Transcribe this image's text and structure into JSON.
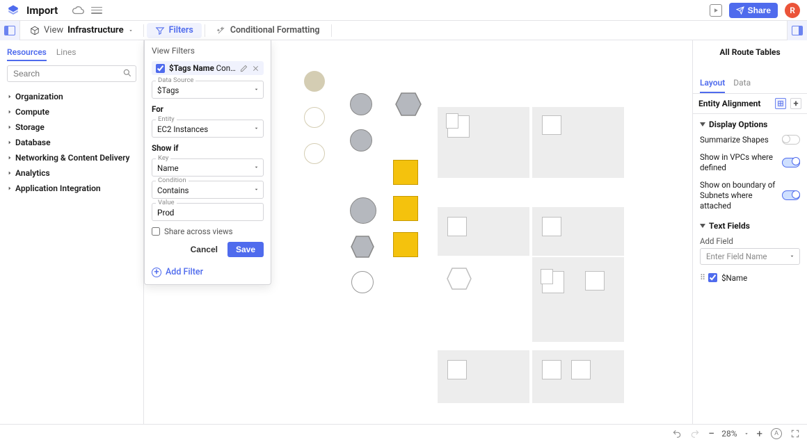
{
  "header": {
    "doc_title": "Import",
    "share_label": "Share",
    "avatar_letter": "R"
  },
  "toolbar": {
    "view_word": "View",
    "view_name": "Infrastructure",
    "filters_label": "Filters",
    "cond_fmt_label": "Conditional Formatting"
  },
  "sidebar": {
    "tabs": [
      "Resources",
      "Lines"
    ],
    "active_tab": 0,
    "search_placeholder": "Search",
    "tree": [
      "Organization",
      "Compute",
      "Storage",
      "Database",
      "Networking & Content Delivery",
      "Analytics",
      "Application Integration"
    ]
  },
  "filter_panel": {
    "title": "View Filters",
    "chip_field": "$Tags Name",
    "chip_condition": "Contains",
    "chip_value": "Prod",
    "data_source_label": "Data Source",
    "data_source_value": "$Tags",
    "for_label": "For",
    "entity_label": "Entity",
    "entity_value": "EC2 Instances",
    "show_if_label": "Show if",
    "key_label": "Key",
    "key_value": "Name",
    "condition_label": "Condition",
    "condition_value": "Contains",
    "value_label": "Value",
    "value_value": "Prod",
    "share_label": "Share across views",
    "cancel_label": "Cancel",
    "save_label": "Save",
    "add_filter_label": "Add Filter"
  },
  "right": {
    "title": "All Route Tables",
    "tabs": [
      "Layout",
      "Data"
    ],
    "active_tab": 0,
    "ea_title": "Entity Alignment",
    "display_options": "Display Options",
    "opt1": "Summarize Shapes",
    "opt2": "Show in VPCs where defined",
    "opt3": "Show on boundary of Subnets where attached",
    "text_fields": "Text Fields",
    "add_field": "Add Field",
    "add_field_placeholder": "Enter Field Name",
    "field1": "$Name"
  },
  "status": {
    "zoom": "28%"
  }
}
